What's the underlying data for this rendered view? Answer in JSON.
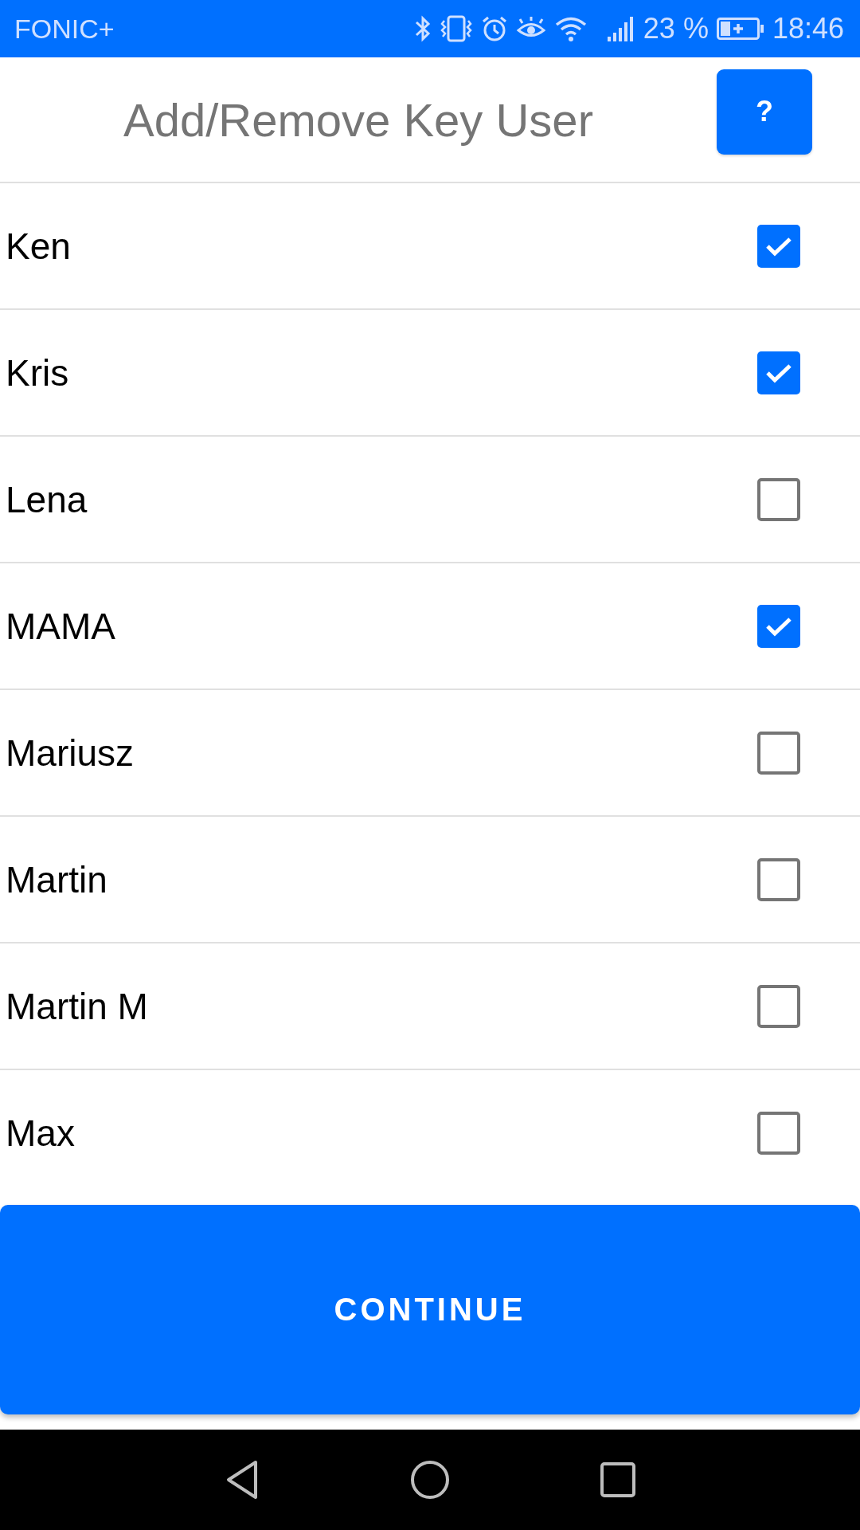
{
  "status_bar": {
    "carrier": "FONIC+",
    "battery": "23 %",
    "time": "18:46"
  },
  "header": {
    "title": "Add/Remove Key User",
    "help_button": "?"
  },
  "users": [
    {
      "name": "Ken",
      "checked": true
    },
    {
      "name": "Kris",
      "checked": true
    },
    {
      "name": "Lena",
      "checked": false
    },
    {
      "name": "MAMA",
      "checked": true
    },
    {
      "name": "Mariusz",
      "checked": false
    },
    {
      "name": "Martin",
      "checked": false
    },
    {
      "name": "Martin M",
      "checked": false
    },
    {
      "name": "Max",
      "checked": false
    }
  ],
  "continue_button": "CONTINUE"
}
